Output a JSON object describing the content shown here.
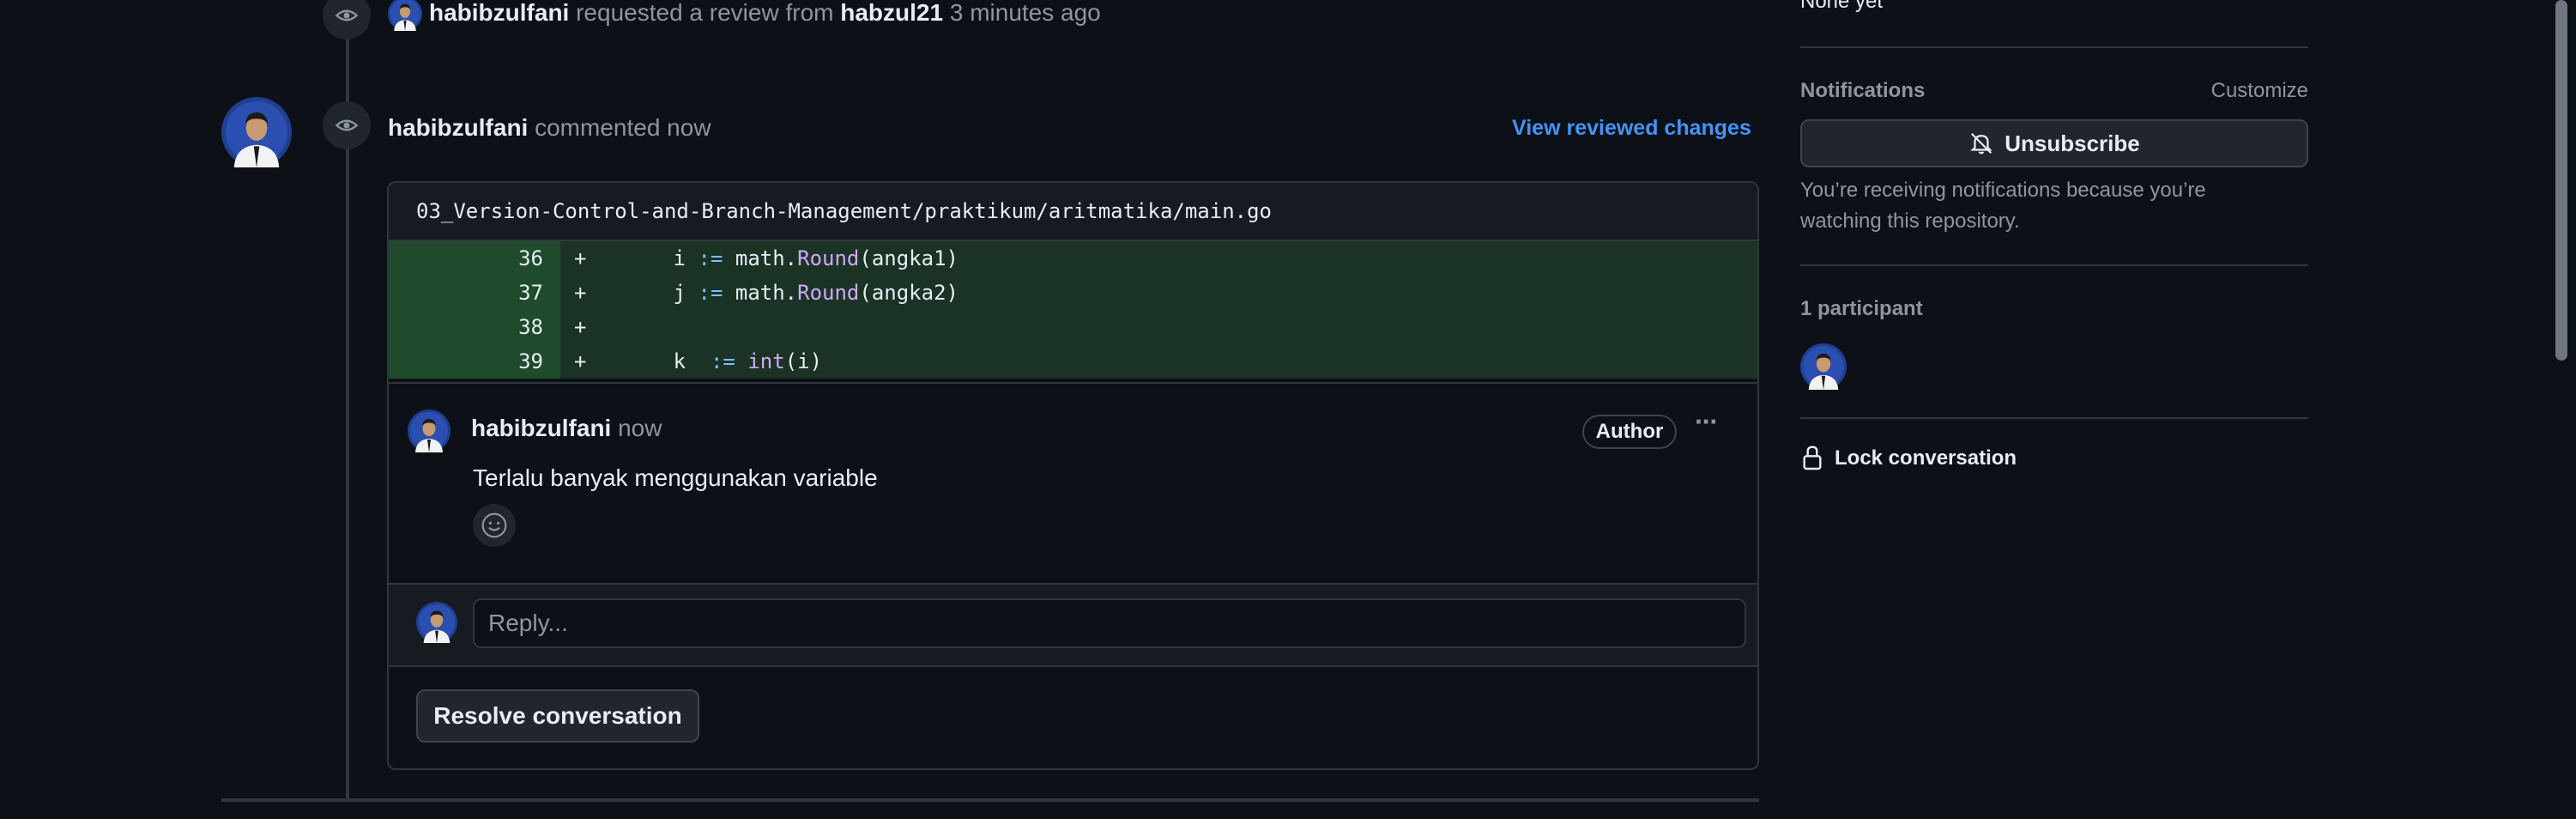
{
  "timeline": {
    "review_request": {
      "actor": "habibzulfani",
      "action": "requested a review from",
      "reviewer": "habzul21",
      "time": "3 minutes ago"
    },
    "comment_event": {
      "actor": "habibzulfani",
      "action": "commented now",
      "view_changes_link": "View reviewed changes"
    }
  },
  "code_review": {
    "file_path": "03_Version-Control-and-Branch-Management/praktikum/aritmatika/main.go",
    "lines": [
      {
        "num": "36",
        "sign": "+",
        "indent": "       ",
        "var": "i",
        "op": ":=",
        "obj": "math.",
        "fn": "Round",
        "args": "(angka1)"
      },
      {
        "num": "37",
        "sign": "+",
        "indent": "       ",
        "var": "j",
        "op": ":=",
        "obj": "math.",
        "fn": "Round",
        "args": "(angka2)"
      },
      {
        "num": "38",
        "sign": "+",
        "indent": "",
        "var": "",
        "op": "",
        "obj": "",
        "fn": "",
        "args": ""
      },
      {
        "num": "39",
        "sign": "+",
        "indent": "       ",
        "var": "k ",
        "op": ":=",
        "obj": "",
        "fn": "int",
        "args": "(i)"
      }
    ],
    "comment": {
      "author": "habibzulfani",
      "time": "now",
      "badge": "Author",
      "more_label": "···",
      "body": "Terlalu banyak menggunakan variable"
    },
    "reply_placeholder": "Reply...",
    "resolve_label": "Resolve conversation"
  },
  "sidebar": {
    "milestone_value": "None yet",
    "notifications": {
      "heading": "Notifications",
      "customize": "Customize",
      "button": "Unsubscribe",
      "note": "You’re receiving notifications because you’re watching this repository."
    },
    "participants_heading": "1 participant",
    "lock_label": "Lock conversation"
  },
  "colors": {
    "background": "#0d1117",
    "link": "#4493f8",
    "diff_added_line": "#1f4a2b",
    "diff_added_code": "#1a3324"
  }
}
